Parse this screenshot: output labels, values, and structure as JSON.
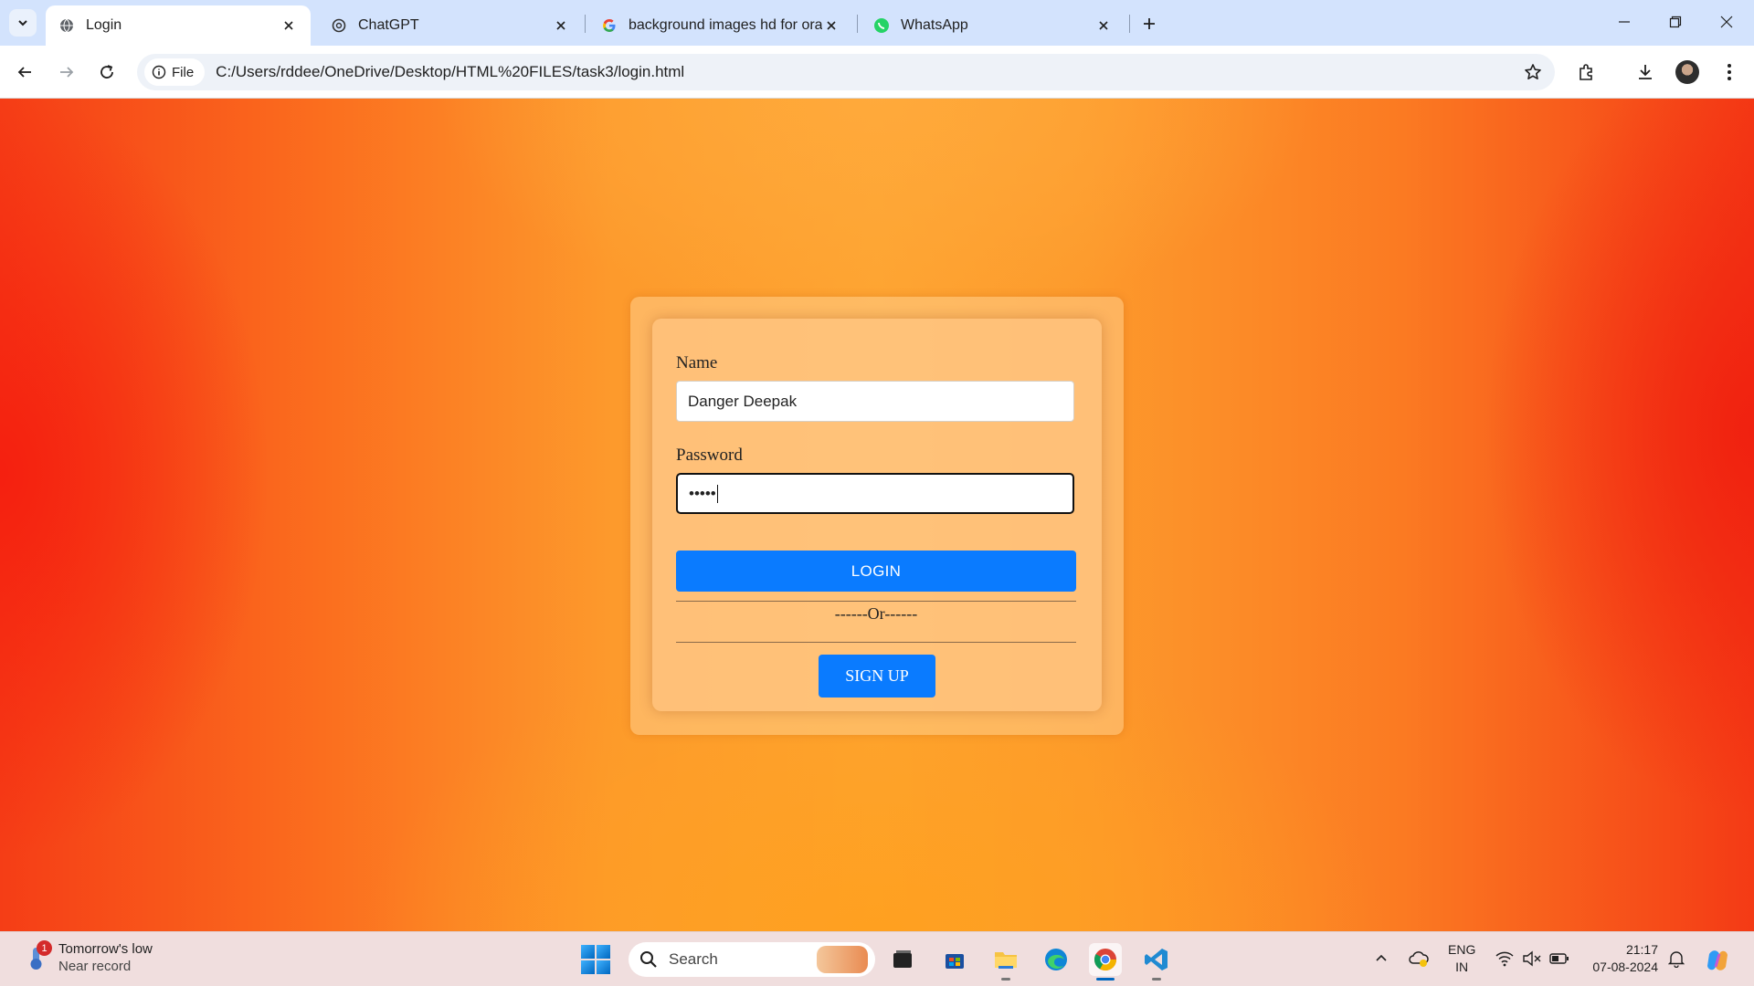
{
  "browser": {
    "tabs": [
      {
        "title": "Login",
        "active": true
      },
      {
        "title": "ChatGPT",
        "active": false
      },
      {
        "title": "background images hd for oran",
        "active": false
      },
      {
        "title": "WhatsApp",
        "active": false
      }
    ],
    "address": {
      "chip_label": "File",
      "url": "C:/Users/rddee/OneDrive/Desktop/HTML%20FILES/task3/login.html"
    }
  },
  "login_form": {
    "name_label": "Name",
    "name_value": "Danger Deepak",
    "password_label": "Password",
    "password_masked": "•••••",
    "login_button": "LOGIN",
    "or_text": "------Or------",
    "signup_button": "SIGN UP"
  },
  "taskbar": {
    "weather": {
      "line1": "Tomorrow's low",
      "line2": "Near record",
      "badge": "1"
    },
    "search_placeholder": "Search",
    "language": {
      "line1": "ENG",
      "line2": "IN"
    },
    "clock": {
      "time": "21:17",
      "date": "07-08-2024"
    }
  },
  "colors": {
    "accent_button": "#0a7bff",
    "tab_strip": "#d3e3fd",
    "page_bg_center": "#fea431",
    "page_bg_edge": "#f53d16"
  }
}
